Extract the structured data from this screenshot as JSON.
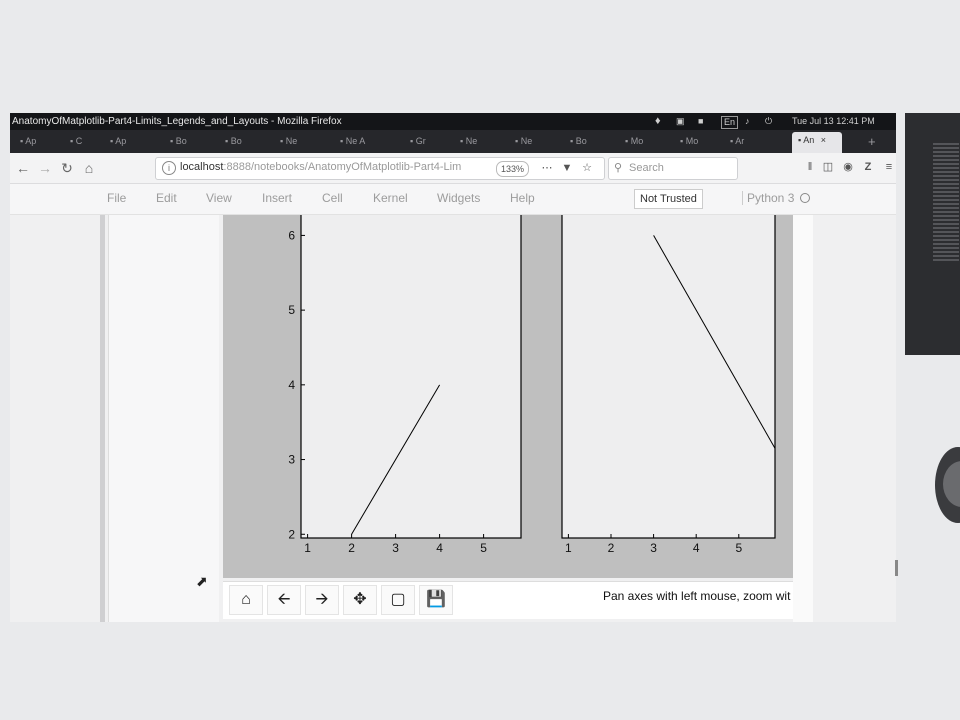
{
  "window": {
    "title": "AnatomyOfMatplotlib-Part4-Limits_Legends_and_Layouts - Mozilla Firefox",
    "tray_time": "Tue Jul 13 12:41 PM",
    "tray_en": "En"
  },
  "tabs": [
    {
      "label": "Ap"
    },
    {
      "label": "C"
    },
    {
      "label": "Ap"
    },
    {
      "label": "Bo"
    },
    {
      "label": "Bo"
    },
    {
      "label": "Ne"
    },
    {
      "label": "Ne A"
    },
    {
      "label": "Gr"
    },
    {
      "label": "Ne"
    },
    {
      "label": "Ne"
    },
    {
      "label": "Bo"
    },
    {
      "label": "Mo"
    },
    {
      "label": "Mo"
    },
    {
      "label": "Ar"
    }
  ],
  "active_tab": {
    "label": "An"
  },
  "navbar": {
    "url_host": "localhost",
    "url_rest": ":8888/notebooks/AnatomyOfMatplotlib-Part4-Lim",
    "zoom": "133%",
    "search_placeholder": "Search"
  },
  "jupyter": {
    "menus": [
      "File",
      "Edit",
      "View",
      "Insert",
      "Cell",
      "Kernel",
      "Widgets",
      "Help"
    ],
    "trust": "Not Trusted",
    "kernel": "Python 3"
  },
  "figure": {
    "status": "Pan axes with left mouse, zoom wit"
  },
  "chart_data": [
    {
      "type": "line",
      "x": [
        2,
        4
      ],
      "y": [
        2,
        4
      ],
      "xlim": [
        0.85,
        5.85
      ],
      "ylim": [
        1.95,
        6.3
      ],
      "xticks": [
        "1",
        "2",
        "3",
        "4",
        "5"
      ],
      "yticks": [
        "2",
        "3",
        "4",
        "5",
        "6"
      ],
      "grid": false
    },
    {
      "type": "line",
      "x": [
        3,
        5.9
      ],
      "y": [
        6,
        3.1
      ],
      "xlim": [
        0.85,
        5.85
      ],
      "xticks": [
        "1",
        "2",
        "3",
        "4",
        "5"
      ],
      "grid": false
    }
  ],
  "colors": {
    "titlebar": "#141518",
    "figure_bg": "#bfbfbf",
    "axes_bg": "#eeeeef",
    "line": "#000000"
  }
}
